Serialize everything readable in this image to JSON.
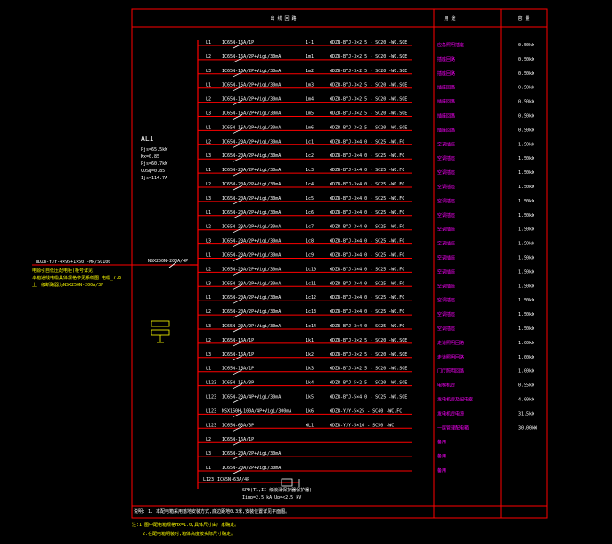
{
  "header": {
    "col_main": "出 线 回 路",
    "col_use": "用 途",
    "col_power": "容 量"
  },
  "panel": {
    "name": "AL1",
    "params": [
      "Pjs=65.5kW",
      "Kx=0.85",
      "Pjs=60.7kW",
      "COSφ=0.85",
      "Ijs=114.7A"
    ]
  },
  "incoming": {
    "cable": "WDZB-YJY-4×95+1×50 -MR/SC100",
    "notes": [
      "电源引自低压配电柜(柜号详见)",
      "本箱进线电缆具体规格参见系统图 电缆_7.8",
      "上一级断路器为NSX250N-200A/3P"
    ],
    "breaker": "NSX250N-200A/4P"
  },
  "circuits": [
    {
      "phase": "L1",
      "breaker": "IC65N-16A/1P",
      "id": "1-1",
      "cable": "WDZN-BYJ-3×2.5 - SC20 -WC.SCE",
      "use": "应急照明插座",
      "power": "0.50kW"
    },
    {
      "phase": "L2",
      "breaker": "IC65N-16A/2P+Vigi/30mA",
      "id": "1m1",
      "cable": "WDZB-BYJ-3×2.5 - SC20 -WC.SCE",
      "use": "插座回路",
      "power": "0.50kW"
    },
    {
      "phase": "L3",
      "breaker": "IC65N-16A/2P+Vigi/30mA",
      "id": "1m2",
      "cable": "WDZB-BYJ-3×2.5 - SC20 -WC.SCE",
      "use": "插座回路",
      "power": "0.50kW"
    },
    {
      "phase": "L1",
      "breaker": "IC65N-16A/2P+Vigi/30mA",
      "id": "1m3",
      "cable": "WDZB-BYJ-3×2.5 - SC20 -WC.SCE",
      "use": "插座回路",
      "power": "0.50kW"
    },
    {
      "phase": "L2",
      "breaker": "IC65N-16A/2P+Vigi/30mA",
      "id": "1m4",
      "cable": "WDZB-BYJ-3×2.5 - SC20 -WC.SCE",
      "use": "插座回路",
      "power": "0.50kW"
    },
    {
      "phase": "L3",
      "breaker": "IC65N-16A/2P+Vigi/30mA",
      "id": "1m5",
      "cable": "WDZB-BYJ-3×2.5 - SC20 -WC.SCE",
      "use": "插座回路",
      "power": "0.50kW"
    },
    {
      "phase": "L1",
      "breaker": "IC65N-16A/2P+Vigi/30mA",
      "id": "1m6",
      "cable": "WDZB-BYJ-3×2.5 - SC20 -WC.SCE",
      "use": "插座回路",
      "power": "0.50kW"
    },
    {
      "phase": "L2",
      "breaker": "IC65N-20A/2P+Vigi/30mA",
      "id": "1c1",
      "cable": "WDZB-BYJ-3×4.0 - SC25 -WC.FC",
      "use": "空调插座",
      "power": "1.50kW"
    },
    {
      "phase": "L3",
      "breaker": "IC65N-20A/2P+Vigi/30mA",
      "id": "1c2",
      "cable": "WDZB-BYJ-3×4.0 - SC25 -WC.FC",
      "use": "空调插座",
      "power": "1.50kW"
    },
    {
      "phase": "L1",
      "breaker": "IC65N-20A/2P+Vigi/30mA",
      "id": "1c3",
      "cable": "WDZB-BYJ-3×4.0 - SC25 -WC.FC",
      "use": "空调插座",
      "power": "1.50kW"
    },
    {
      "phase": "L2",
      "breaker": "IC65N-20A/2P+Vigi/30mA",
      "id": "1c4",
      "cable": "WDZB-BYJ-3×4.0 - SC25 -WC.FC",
      "use": "空调插座",
      "power": "1.50kW"
    },
    {
      "phase": "L3",
      "breaker": "IC65N-20A/2P+Vigi/30mA",
      "id": "1c5",
      "cable": "WDZB-BYJ-3×4.0 - SC25 -WC.FC",
      "use": "空调插座",
      "power": "1.50kW"
    },
    {
      "phase": "L1",
      "breaker": "IC65N-20A/2P+Vigi/30mA",
      "id": "1c6",
      "cable": "WDZB-BYJ-3×4.0 - SC25 -WC.FC",
      "use": "空调插座",
      "power": "1.50kW"
    },
    {
      "phase": "L2",
      "breaker": "IC65N-20A/2P+Vigi/30mA",
      "id": "1c7",
      "cable": "WDZB-BYJ-3×4.0 - SC25 -WC.FC",
      "use": "空调插座",
      "power": "1.50kW"
    },
    {
      "phase": "L3",
      "breaker": "IC65N-20A/2P+Vigi/30mA",
      "id": "1c8",
      "cable": "WDZB-BYJ-3×4.0 - SC25 -WC.FC",
      "use": "空调插座",
      "power": "1.50kW"
    },
    {
      "phase": "L1",
      "breaker": "IC65N-20A/2P+Vigi/30mA",
      "id": "1c9",
      "cable": "WDZB-BYJ-3×4.0 - SC25 -WC.FC",
      "use": "空调插座",
      "power": "1.50kW"
    },
    {
      "phase": "L2",
      "breaker": "IC65N-20A/2P+Vigi/30mA",
      "id": "1c10",
      "cable": "WDZB-BYJ-3×4.0 - SC25 -WC.FC",
      "use": "空调插座",
      "power": "1.50kW"
    },
    {
      "phase": "L3",
      "breaker": "IC65N-20A/2P+Vigi/30mA",
      "id": "1c11",
      "cable": "WDZB-BYJ-3×4.0 - SC25 -WC.FC",
      "use": "空调插座",
      "power": "1.50kW"
    },
    {
      "phase": "L1",
      "breaker": "IC65N-20A/2P+Vigi/30mA",
      "id": "1c12",
      "cable": "WDZB-BYJ-3×4.0 - SC25 -WC.FC",
      "use": "空调插座",
      "power": "1.50kW"
    },
    {
      "phase": "L2",
      "breaker": "IC65N-20A/2P+Vigi/30mA",
      "id": "1c13",
      "cable": "WDZB-BYJ-3×4.0 - SC25 -WC.FC",
      "use": "空调插座",
      "power": "1.50kW"
    },
    {
      "phase": "L3",
      "breaker": "IC65N-20A/2P+Vigi/30mA",
      "id": "1c14",
      "cable": "WDZB-BYJ-3×4.0 - SC25 -WC.FC",
      "use": "空调插座",
      "power": "1.50kW"
    },
    {
      "phase": "L2",
      "breaker": "IC65N-16A/1P",
      "id": "1k1",
      "cable": "WDZB-BYJ-3×2.5 - SC20 -WC.SCE",
      "use": "走道照明回路",
      "power": "1.00kW"
    },
    {
      "phase": "L3",
      "breaker": "IC65N-16A/1P",
      "id": "1k2",
      "cable": "WDZB-BYJ-3×2.5 - SC20 -WC.SCE",
      "use": "走道照明回路",
      "power": "1.00kW"
    },
    {
      "phase": "L1",
      "breaker": "IC65N-16A/1P",
      "id": "1k3",
      "cable": "WDZB-BYJ-3×2.5 - SC20 -WC.SCE",
      "use": "门厅照明回路",
      "power": "1.00kW"
    },
    {
      "phase": "L123",
      "breaker": "IC65N-16A/3P",
      "id": "1k4",
      "cable": "WDZB-BYJ-5×2.5 - SC20 -WC.SCE",
      "use": "电梯机房",
      "power": "0.55kW"
    },
    {
      "phase": "L123",
      "breaker": "IC65N-20A/4P+Vigi/30mA",
      "id": "1k5",
      "cable": "WDZB-BYJ-5×4.0 - SC25 -WC.SCE",
      "use": "发电机房及配电室",
      "power": "4.00kW"
    },
    {
      "phase": "L123",
      "breaker": "NSX160H-100A/4P+Vigi/300mA",
      "id": "1k6",
      "cable": "WDZB-YJY-5×25 - SC40 -WC.FC",
      "use": "发电机房电源",
      "power": "31.5kW"
    },
    {
      "phase": "L123",
      "breaker": "IC65N-63A/3P",
      "id": "WL1",
      "cable": "WDZB-YJY-5×16 - SC50 -WC",
      "use": "一层管理配电箱",
      "power": "30.00kW"
    },
    {
      "phase": "L2",
      "breaker": "IC65N-16A/1P",
      "id": "",
      "cable": "",
      "use": "备用",
      "power": ""
    },
    {
      "phase": "L3",
      "breaker": "IC65N-20A/2P+Vigi/30mA",
      "id": "",
      "cable": "",
      "use": "备用",
      "power": ""
    },
    {
      "phase": "L1",
      "breaker": "IC65N-20A/2P+Vigi/30mA",
      "id": "",
      "cable": "",
      "use": "备用",
      "power": ""
    }
  ],
  "spd": {
    "phase": "L123",
    "breaker": "IC65N-63A/4P",
    "lines": [
      "SPD(T1,II—级浪涌保护器保护器)",
      "Iimp=2.5 kA,Up=<2.5 kV"
    ]
  },
  "footnote": "说明: 1. 本配电箱采用落地安装方式,底边距地0.3米,安装位置详见平面图。",
  "bottom_notes": [
    "注:1.图中配电箱规格Hx=1.0,具体尺寸由厂家确定。",
    "2.在配电箱明装时,箱体高度按实际尺寸确定。"
  ],
  "colors": {
    "frame": "#ff0000",
    "breaker": "#ffffff",
    "use": "#ff00ff",
    "cable": "#ffffff",
    "accent": "#ffff00"
  }
}
